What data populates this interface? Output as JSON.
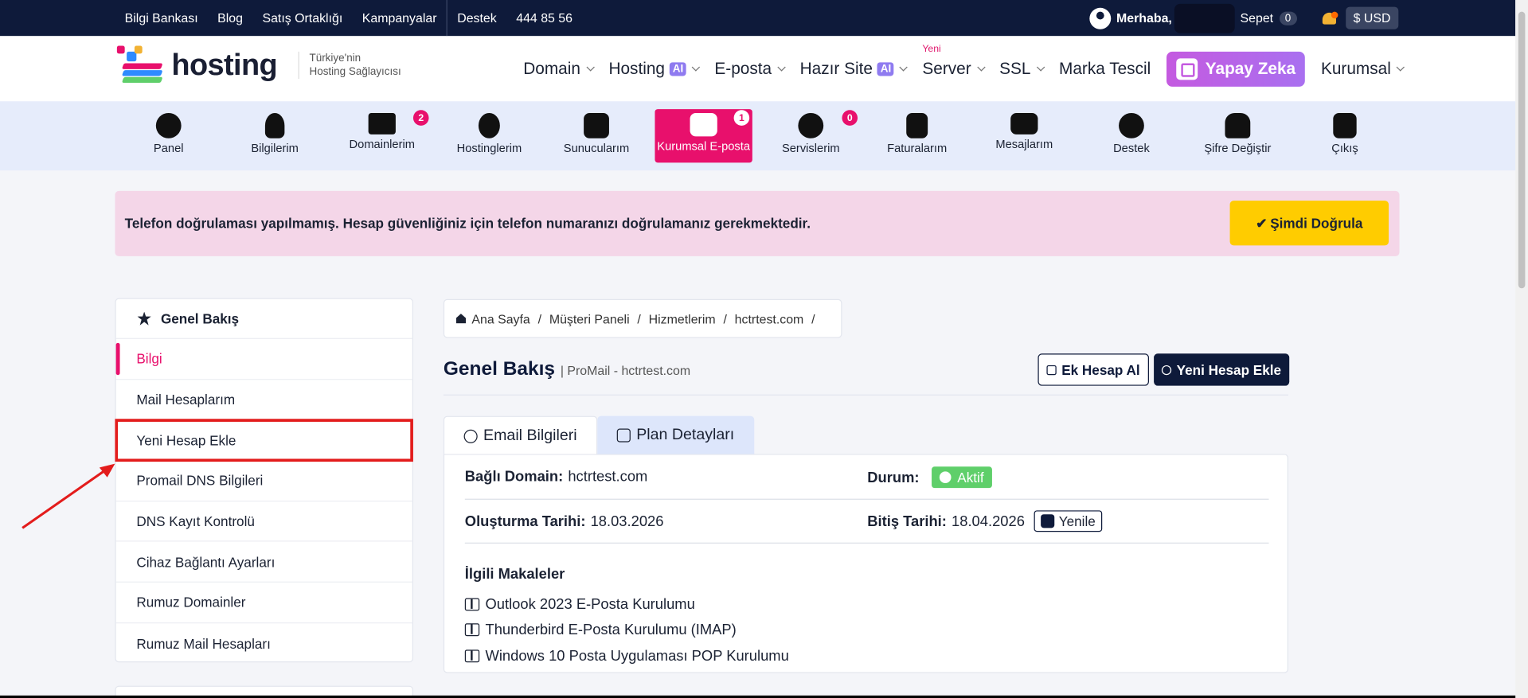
{
  "topbar": {
    "links": [
      "Bilgi Bankası",
      "Blog",
      "Satış Ortaklığı",
      "Kampanyalar"
    ],
    "support": "Destek",
    "phone": "444 85 56",
    "greeting": "Merhaba,",
    "cart_label": "Sepet",
    "cart_count": "0",
    "currency": "$ USD"
  },
  "header": {
    "logo_text": "hosting",
    "tagline_1": "Türkiye'nin",
    "tagline_2": "Hosting Sağlayıcısı",
    "nav": {
      "domain": "Domain",
      "hosting": "Hosting",
      "eposta": "E-posta",
      "hazir_site": "Hazır Site",
      "server": "Server",
      "server_new": "Yeni",
      "ssl": "SSL",
      "marka": "Marka Tescil",
      "yapay_zeka": "Yapay Zeka",
      "kurumsal": "Kurumsal",
      "ai_badge": "AI"
    }
  },
  "iconbar": {
    "items": [
      {
        "label": "Panel",
        "icon": "gear-icon"
      },
      {
        "label": "Bilgilerim",
        "icon": "user-icon"
      },
      {
        "label": "Domainlerim",
        "icon": "www-icon",
        "badge": "2"
      },
      {
        "label": "Hostinglerim",
        "icon": "tree-icon"
      },
      {
        "label": "Sunucularım",
        "icon": "server-icon"
      },
      {
        "label": "Kurumsal E-posta",
        "icon": "envelope-open-icon",
        "badge": "1"
      },
      {
        "label": "Servislerim",
        "icon": "grid-icon",
        "badge": "0"
      },
      {
        "label": "Faturalarım",
        "icon": "invoice-icon"
      },
      {
        "label": "Mesajlarım",
        "icon": "envelope-icon"
      },
      {
        "label": "Destek",
        "icon": "headset-icon"
      },
      {
        "label": "Şifre Değiştir",
        "icon": "lock-icon"
      },
      {
        "label": "Çıkış",
        "icon": "logout-icon"
      }
    ]
  },
  "alert": {
    "text": "Telefon doğrulaması yapılmamış. Hesap güvenliğiniz için telefon numaranızı doğrulamanız gerekmektedir.",
    "button": "Şimdi Doğrula"
  },
  "sidebar": {
    "title": "Genel Bakış",
    "items": [
      "Bilgi",
      "Mail Hesaplarım",
      "Yeni Hesap Ekle",
      "Promail DNS Bilgileri",
      "DNS Kayıt Kontrolü",
      "Cihaz Bağlantı Ayarları",
      "Rumuz Domainler",
      "Rumuz Mail Hesapları"
    ]
  },
  "breadcrumb": [
    "Ana Sayfa",
    "Müşteri Paneli",
    "Hizmetlerim",
    "hctrtest.com"
  ],
  "page": {
    "title": "Genel Bakış",
    "subtitle": "| ProMail - hctrtest.com",
    "btn_ek_hesap": "Ek Hesap Al",
    "btn_yeni_hesap": "Yeni Hesap Ekle"
  },
  "tabs": [
    "Email Bilgileri",
    "Plan Detayları"
  ],
  "details": {
    "domain_label": "Bağlı Domain:",
    "domain_value": "hctrtest.com",
    "status_label": "Durum:",
    "status_value": "Aktif",
    "created_label": "Oluşturma Tarihi:",
    "created_value": "18.03.2026",
    "end_label": "Bitiş Tarihi:",
    "end_value": "18.04.2026",
    "renew": "Yenile",
    "related_title": "İlgili Makaleler",
    "articles": [
      "Outlook 2023 E-Posta Kurulumu",
      "Thunderbird E-Posta Kurulumu (IMAP)",
      "Windows 10 Posta Uygulaması POP Kurulumu"
    ]
  },
  "colors": {
    "navy": "#0e1a3a",
    "pink": "#e8106c",
    "yellow": "#ffcc00",
    "green": "#5fcf6a"
  }
}
